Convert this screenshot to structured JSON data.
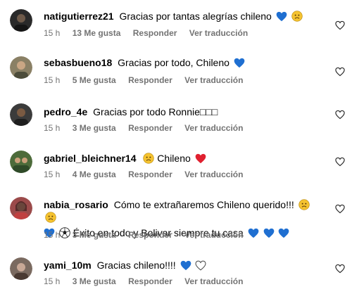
{
  "comments": [
    {
      "username": "natigutierrez21",
      "text": "Gracias por tantas alegrías chileno",
      "emojis": [
        "blue-heart",
        "sad-face"
      ],
      "time": "15 h",
      "likes": "13 Me gusta",
      "reply": "Responder",
      "translate": "Ver traducción",
      "avatar_color": "#2a2a2a"
    },
    {
      "username": "sebasbueno18",
      "text": "Gracias por todo, Chileno",
      "emojis": [
        "blue-heart"
      ],
      "time": "15 h",
      "likes": "5 Me gusta",
      "reply": "Responder",
      "translate": "Ver traducción",
      "avatar_color": "#8a8065"
    },
    {
      "username": "pedro_4e",
      "text": "Gracias por todo Ronnie□□□",
      "emojis": [],
      "time": "15 h",
      "likes": "3 Me gusta",
      "reply": "Responder",
      "translate": "Ver traducción",
      "avatar_color": "#3b3b3b"
    },
    {
      "username": "gabriel_bleichner14",
      "text": "",
      "emojis": [
        "sad-face"
      ],
      "text2": "Chileno",
      "emojis2": [
        "red-heart"
      ],
      "time": "15 h",
      "likes": "4 Me gusta",
      "reply": "Responder",
      "translate": "Ver traducción",
      "avatar_color": "#4d6b3a"
    },
    {
      "username": "nabia_rosario",
      "text": "Cómo te extrañaremos Chileno querido!!!",
      "emojis": [
        "sad-face",
        "sad-face"
      ],
      "line2_pre": [
        "blue-heart",
        "soccer-ball"
      ],
      "line2_text": "Éxito en todo y Bolivar siempre tu casa",
      "line2_post": [
        "blue-heart",
        "blue-heart",
        "blue-heart"
      ],
      "time": "15 h",
      "likes": "3 Me gusta",
      "reply": "Responder",
      "translate": "Ver traducción",
      "avatar_color": "#9b4a4a"
    },
    {
      "username": "yami_10m",
      "text": "Gracias chileno!!!!",
      "emojis": [
        "blue-heart",
        "white-heart"
      ],
      "time": "15 h",
      "likes": "3 Me gusta",
      "reply": "Responder",
      "translate": "Ver traducción",
      "avatar_color": "#7a6a60"
    }
  ]
}
